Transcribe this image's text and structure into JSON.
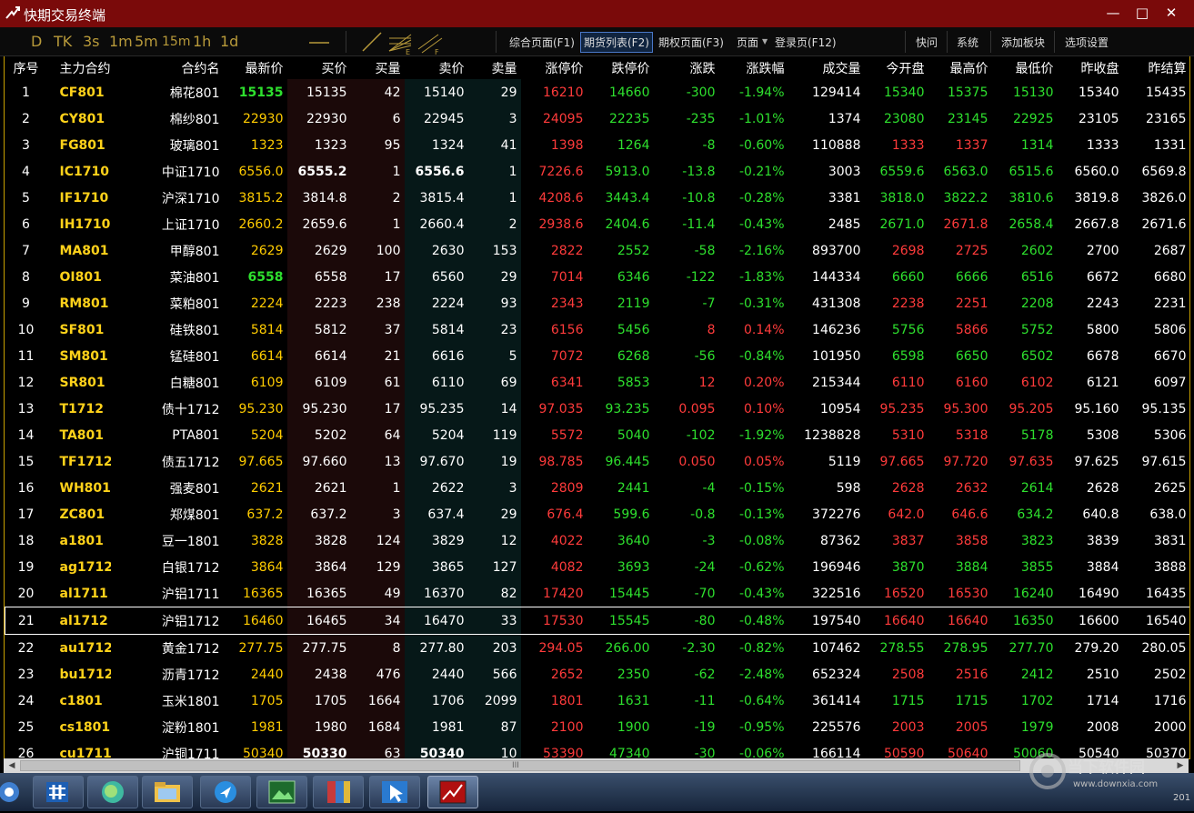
{
  "app": {
    "title": "快期交易终端"
  },
  "window_controls": {
    "minimize": "—",
    "maximize": "□",
    "close": "✕"
  },
  "toolbar": {
    "periods": [
      "D",
      "TK",
      "3s",
      "1m",
      "5m",
      "15m",
      "1h",
      "1d"
    ],
    "nav": [
      "综合页面(F1)",
      "期货列表(F2)",
      "期权页面(F3)",
      "页面",
      "登录页(F12)",
      "快问",
      "系统",
      "添加板块",
      "选项设置"
    ],
    "active_nav": "期货列表(F2)"
  },
  "table": {
    "headers": [
      "序号",
      "主力合约",
      "合约名",
      "最新价",
      "买价",
      "买量",
      "卖价",
      "卖量",
      "涨停价",
      "跌停价",
      "涨跌",
      "涨跌幅",
      "成交量",
      "今开盘",
      "最高价",
      "最低价",
      "昨收盘",
      "昨结算"
    ],
    "selected_row": 21,
    "rows": [
      [
        "1",
        "CF801",
        "棉花801",
        "15135",
        "15135",
        "42",
        "15140",
        "29",
        "16210",
        "14660",
        "-300",
        "-1.94%",
        "129414",
        "15340",
        "15375",
        "15130",
        "15340",
        "15435"
      ],
      [
        "2",
        "CY801",
        "棉纱801",
        "22930",
        "22930",
        "6",
        "22945",
        "3",
        "24095",
        "22235",
        "-235",
        "-1.01%",
        "1374",
        "23080",
        "23145",
        "22925",
        "23105",
        "23165"
      ],
      [
        "3",
        "FG801",
        "玻璃801",
        "1323",
        "1323",
        "95",
        "1324",
        "41",
        "1398",
        "1264",
        "-8",
        "-0.60%",
        "110888",
        "1333",
        "1337",
        "1314",
        "1333",
        "1331"
      ],
      [
        "4",
        "IC1710",
        "中证1710",
        "6556.0",
        "6555.2",
        "1",
        "6556.6",
        "1",
        "7226.6",
        "5913.0",
        "-13.8",
        "-0.21%",
        "3003",
        "6559.6",
        "6563.0",
        "6515.6",
        "6560.0",
        "6569.8"
      ],
      [
        "5",
        "IF1710",
        "沪深1710",
        "3815.2",
        "3814.8",
        "2",
        "3815.4",
        "1",
        "4208.6",
        "3443.4",
        "-10.8",
        "-0.28%",
        "3381",
        "3818.0",
        "3822.2",
        "3810.6",
        "3819.8",
        "3826.0"
      ],
      [
        "6",
        "IH1710",
        "上证1710",
        "2660.2",
        "2659.6",
        "1",
        "2660.4",
        "2",
        "2938.6",
        "2404.6",
        "-11.4",
        "-0.43%",
        "2485",
        "2671.0",
        "2671.8",
        "2658.4",
        "2667.8",
        "2671.6"
      ],
      [
        "7",
        "MA801",
        "甲醇801",
        "2629",
        "2629",
        "100",
        "2630",
        "153",
        "2822",
        "2552",
        "-58",
        "-2.16%",
        "893700",
        "2698",
        "2725",
        "2602",
        "2700",
        "2687"
      ],
      [
        "8",
        "OI801",
        "菜油801",
        "6558",
        "6558",
        "17",
        "6560",
        "29",
        "7014",
        "6346",
        "-122",
        "-1.83%",
        "144334",
        "6660",
        "6666",
        "6516",
        "6672",
        "6680"
      ],
      [
        "9",
        "RM801",
        "菜粕801",
        "2224",
        "2223",
        "238",
        "2224",
        "93",
        "2343",
        "2119",
        "-7",
        "-0.31%",
        "431308",
        "2238",
        "2251",
        "2208",
        "2243",
        "2231"
      ],
      [
        "10",
        "SF801",
        "硅铁801",
        "5814",
        "5812",
        "37",
        "5814",
        "23",
        "6156",
        "5456",
        "8",
        "0.14%",
        "146236",
        "5756",
        "5866",
        "5752",
        "5800",
        "5806"
      ],
      [
        "11",
        "SM801",
        "锰硅801",
        "6614",
        "6614",
        "21",
        "6616",
        "5",
        "7072",
        "6268",
        "-56",
        "-0.84%",
        "101950",
        "6598",
        "6650",
        "6502",
        "6678",
        "6670"
      ],
      [
        "12",
        "SR801",
        "白糖801",
        "6109",
        "6109",
        "61",
        "6110",
        "69",
        "6341",
        "5853",
        "12",
        "0.20%",
        "215344",
        "6110",
        "6160",
        "6102",
        "6121",
        "6097"
      ],
      [
        "13",
        "T1712",
        "债十1712",
        "95.230",
        "95.230",
        "17",
        "95.235",
        "14",
        "97.035",
        "93.235",
        "0.095",
        "0.10%",
        "10954",
        "95.235",
        "95.300",
        "95.205",
        "95.160",
        "95.135"
      ],
      [
        "14",
        "TA801",
        "PTA801",
        "5204",
        "5202",
        "64",
        "5204",
        "119",
        "5572",
        "5040",
        "-102",
        "-1.92%",
        "1238828",
        "5310",
        "5318",
        "5178",
        "5308",
        "5306"
      ],
      [
        "15",
        "TF1712",
        "债五1712",
        "97.665",
        "97.660",
        "13",
        "97.670",
        "19",
        "98.785",
        "96.445",
        "0.050",
        "0.05%",
        "5119",
        "97.665",
        "97.720",
        "97.635",
        "97.625",
        "97.615"
      ],
      [
        "16",
        "WH801",
        "强麦801",
        "2621",
        "2621",
        "1",
        "2622",
        "3",
        "2809",
        "2441",
        "-4",
        "-0.15%",
        "598",
        "2628",
        "2632",
        "2614",
        "2628",
        "2625"
      ],
      [
        "17",
        "ZC801",
        "郑煤801",
        "637.2",
        "637.2",
        "3",
        "637.4",
        "29",
        "676.4",
        "599.6",
        "-0.8",
        "-0.13%",
        "372276",
        "642.0",
        "646.6",
        "634.2",
        "640.8",
        "638.0"
      ],
      [
        "18",
        "a1801",
        "豆一1801",
        "3828",
        "3828",
        "124",
        "3829",
        "12",
        "4022",
        "3640",
        "-3",
        "-0.08%",
        "87362",
        "3837",
        "3858",
        "3823",
        "3839",
        "3831"
      ],
      [
        "19",
        "ag1712",
        "白银1712",
        "3864",
        "3864",
        "129",
        "3865",
        "127",
        "4082",
        "3693",
        "-24",
        "-0.62%",
        "196946",
        "3870",
        "3884",
        "3855",
        "3884",
        "3888"
      ],
      [
        "20",
        "al1711",
        "沪铝1711",
        "16365",
        "16365",
        "49",
        "16370",
        "82",
        "17420",
        "15445",
        "-70",
        "-0.43%",
        "322516",
        "16520",
        "16530",
        "16240",
        "16490",
        "16435"
      ],
      [
        "21",
        "al1712",
        "沪铝1712",
        "16460",
        "16465",
        "34",
        "16470",
        "33",
        "17530",
        "15545",
        "-80",
        "-0.48%",
        "197540",
        "16640",
        "16640",
        "16350",
        "16600",
        "16540"
      ],
      [
        "22",
        "au1712",
        "黄金1712",
        "277.75",
        "277.75",
        "8",
        "277.80",
        "203",
        "294.05",
        "266.00",
        "-2.30",
        "-0.82%",
        "107462",
        "278.55",
        "278.95",
        "277.70",
        "279.20",
        "280.05"
      ],
      [
        "23",
        "bu1712",
        "沥青1712",
        "2440",
        "2438",
        "476",
        "2440",
        "566",
        "2652",
        "2350",
        "-62",
        "-2.48%",
        "652324",
        "2508",
        "2516",
        "2412",
        "2510",
        "2502"
      ],
      [
        "24",
        "c1801",
        "玉米1801",
        "1705",
        "1705",
        "1664",
        "1706",
        "2099",
        "1801",
        "1631",
        "-11",
        "-0.64%",
        "361414",
        "1715",
        "1715",
        "1702",
        "1714",
        "1716"
      ],
      [
        "25",
        "cs1801",
        "淀粉1801",
        "1981",
        "1980",
        "1684",
        "1981",
        "87",
        "2100",
        "1900",
        "-19",
        "-0.95%",
        "225576",
        "2003",
        "2005",
        "1979",
        "2008",
        "2000"
      ],
      [
        "26",
        "cu1711",
        "沪铜1711",
        "50340",
        "50330",
        "63",
        "50340",
        "10",
        "53390",
        "47340",
        "-30",
        "-0.06%",
        "166114",
        "50590",
        "50640",
        "50060",
        "50540",
        "50370"
      ]
    ],
    "green_last_rows": [
      1,
      8
    ],
    "bold_rows": [
      4,
      26
    ]
  },
  "scrollbar": {
    "left": "◀",
    "right": "▶",
    "grip": "III"
  },
  "watermark": {
    "name": "当下软件园",
    "url": "www.downxia.com"
  },
  "taskbar": {
    "clock": "201"
  },
  "colors": {
    "up": "#ff3b3b",
    "down": "#2ee02e",
    "latest": "#ffcc00",
    "code": "#ffd21a",
    "title_bar": "#7a0a0a",
    "frame": "#c8a000"
  }
}
